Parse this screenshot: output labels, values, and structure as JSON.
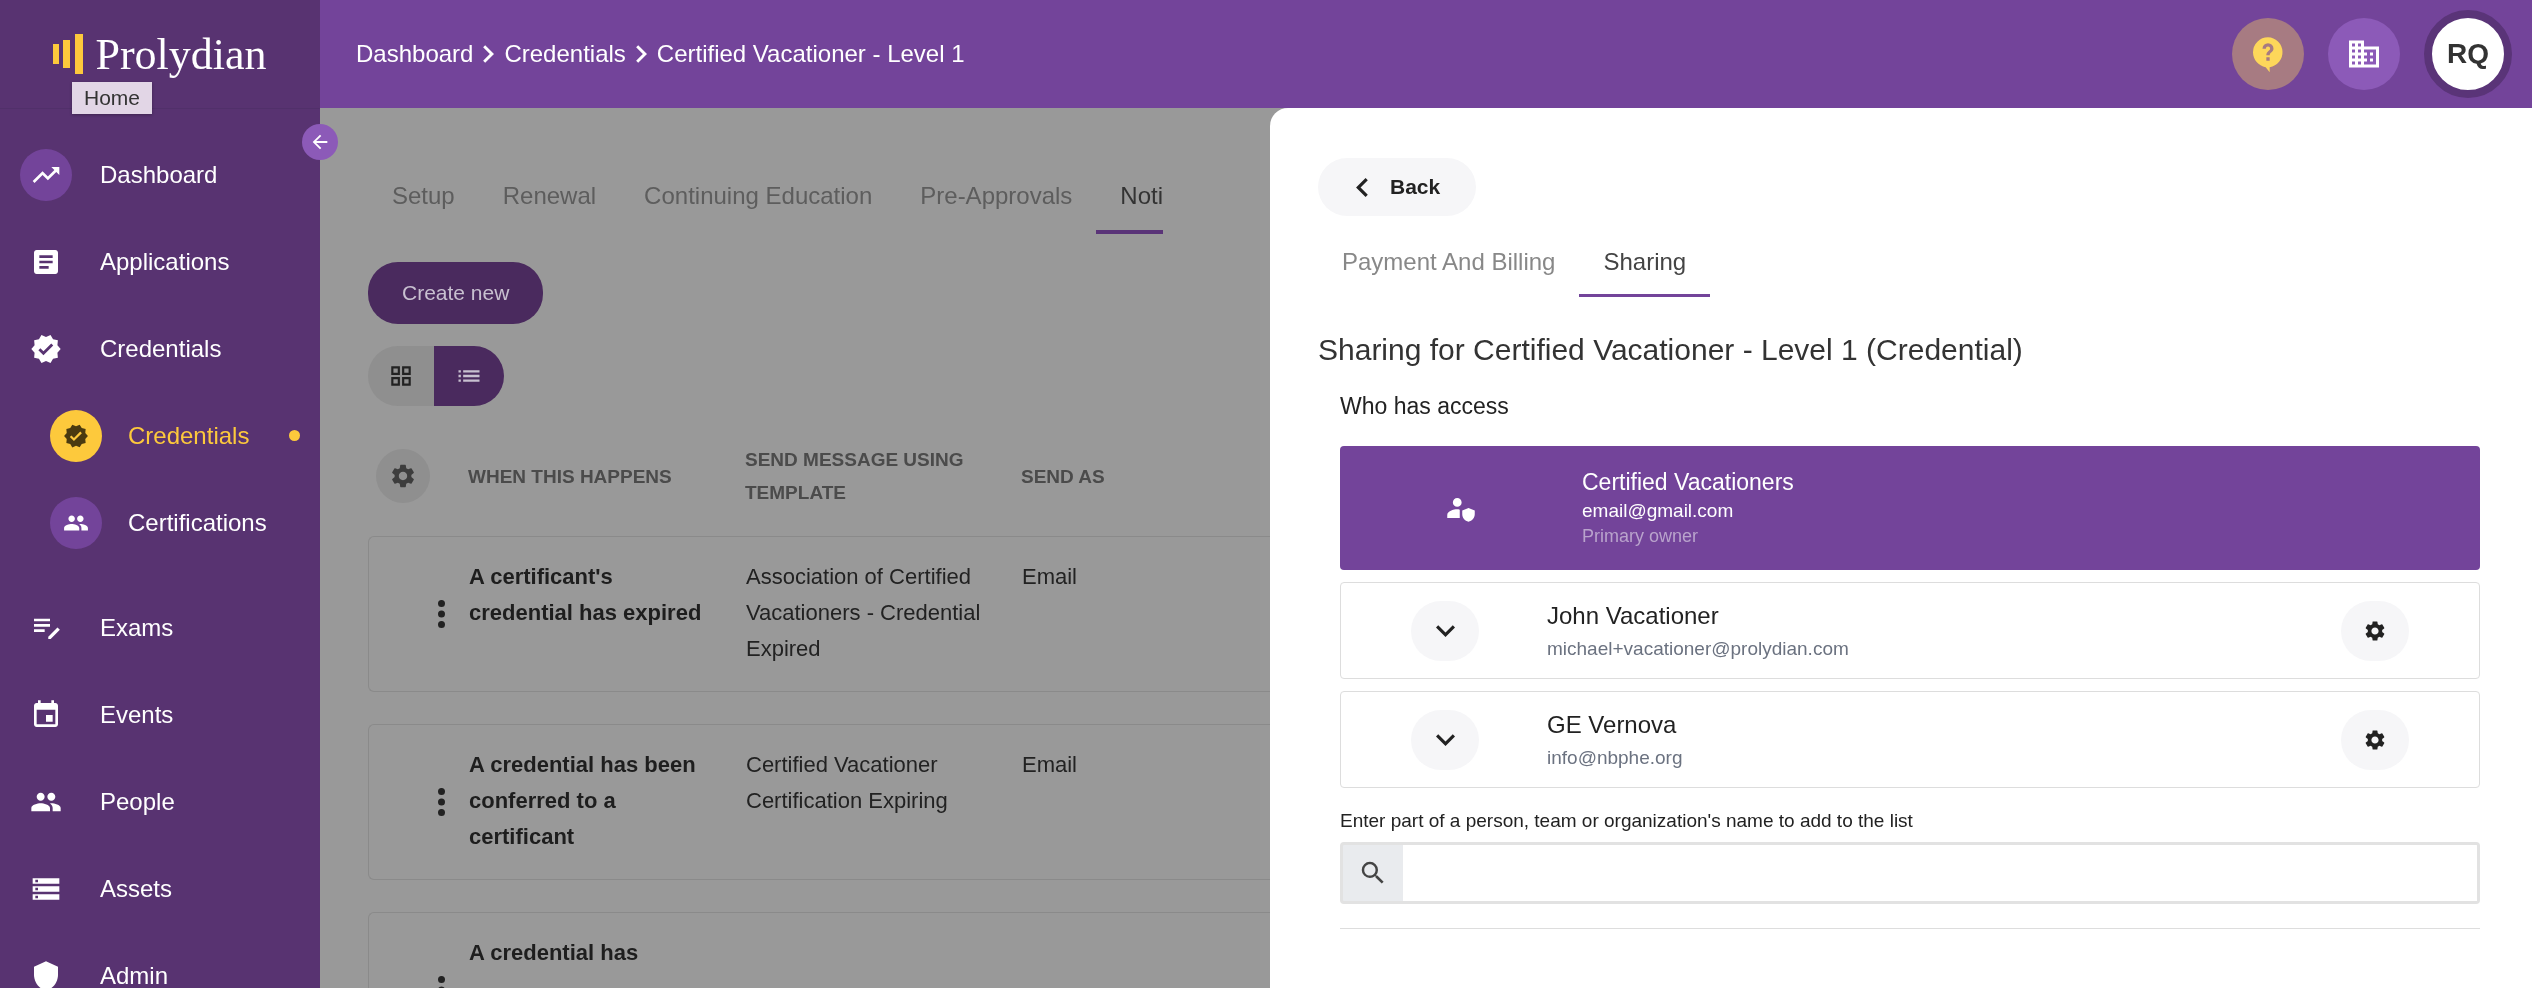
{
  "sidebar": {
    "logo": "Prolydian",
    "tooltip": "Home",
    "items": [
      {
        "label": "Dashboard",
        "hovered": true,
        "selected": false
      },
      {
        "label": "Applications",
        "hovered": false,
        "selected": false
      },
      {
        "label": "Credentials",
        "hovered": false,
        "selected": false,
        "children": [
          {
            "label": "Credentials",
            "selected": true
          },
          {
            "label": "Certifications",
            "selected": false
          }
        ]
      },
      {
        "label": "Exams",
        "hovered": false,
        "selected": false
      },
      {
        "label": "Events",
        "hovered": false,
        "selected": false
      },
      {
        "label": "People",
        "hovered": false,
        "selected": false
      },
      {
        "label": "Assets",
        "hovered": false,
        "selected": false
      },
      {
        "label": "Admin",
        "hovered": false,
        "selected": false
      }
    ]
  },
  "topbar": {
    "breadcrumbs": [
      "Dashboard",
      "Credentials",
      "Certified Vacationer - Level 1"
    ],
    "avatar": "RQ"
  },
  "main": {
    "tabs": [
      {
        "label": "Setup",
        "selected": false
      },
      {
        "label": "Renewal",
        "selected": false
      },
      {
        "label": "Continuing Education",
        "selected": false
      },
      {
        "label": "Pre-Approvals",
        "selected": false
      },
      {
        "label": "Noti",
        "selected": true
      }
    ],
    "create_button": "Create new",
    "view_toggle": [
      {
        "kind": "grid",
        "selected": false
      },
      {
        "kind": "list",
        "selected": true
      }
    ],
    "table": {
      "columns": [
        "WHEN THIS HAPPENS",
        "SEND MESSAGE USING TEMPLATE",
        "SEND AS"
      ],
      "rows": [
        {
          "event": "A certificant's credential has expired",
          "template": "Association of Certified Vacationers - Credential Expired",
          "send_as": "Email"
        },
        {
          "event": "A credential has been conferred to a certificant",
          "template": "Certified Vacationer Certification Expiring",
          "send_as": "Email"
        },
        {
          "event": "A credential has"
        }
      ]
    }
  },
  "drawer": {
    "back": "Back",
    "tabs": [
      {
        "label": "Payment And Billing",
        "selected": false
      },
      {
        "label": "Sharing",
        "selected": true
      }
    ],
    "title": "Sharing for Certified Vacationer - Level 1 (Credential)",
    "access_label": "Who has access",
    "owner": {
      "name": "Certified Vacationers",
      "email": "email@gmail.com",
      "role": "Primary owner"
    },
    "members": [
      {
        "name": "John Vacationer",
        "email": "michael+vacationer@prolydian.com"
      },
      {
        "name": "GE Vernova",
        "email": "info@nbphe.org"
      }
    ],
    "search": {
      "label": "Enter part of a person, team or organization's name to add to the list"
    }
  }
}
